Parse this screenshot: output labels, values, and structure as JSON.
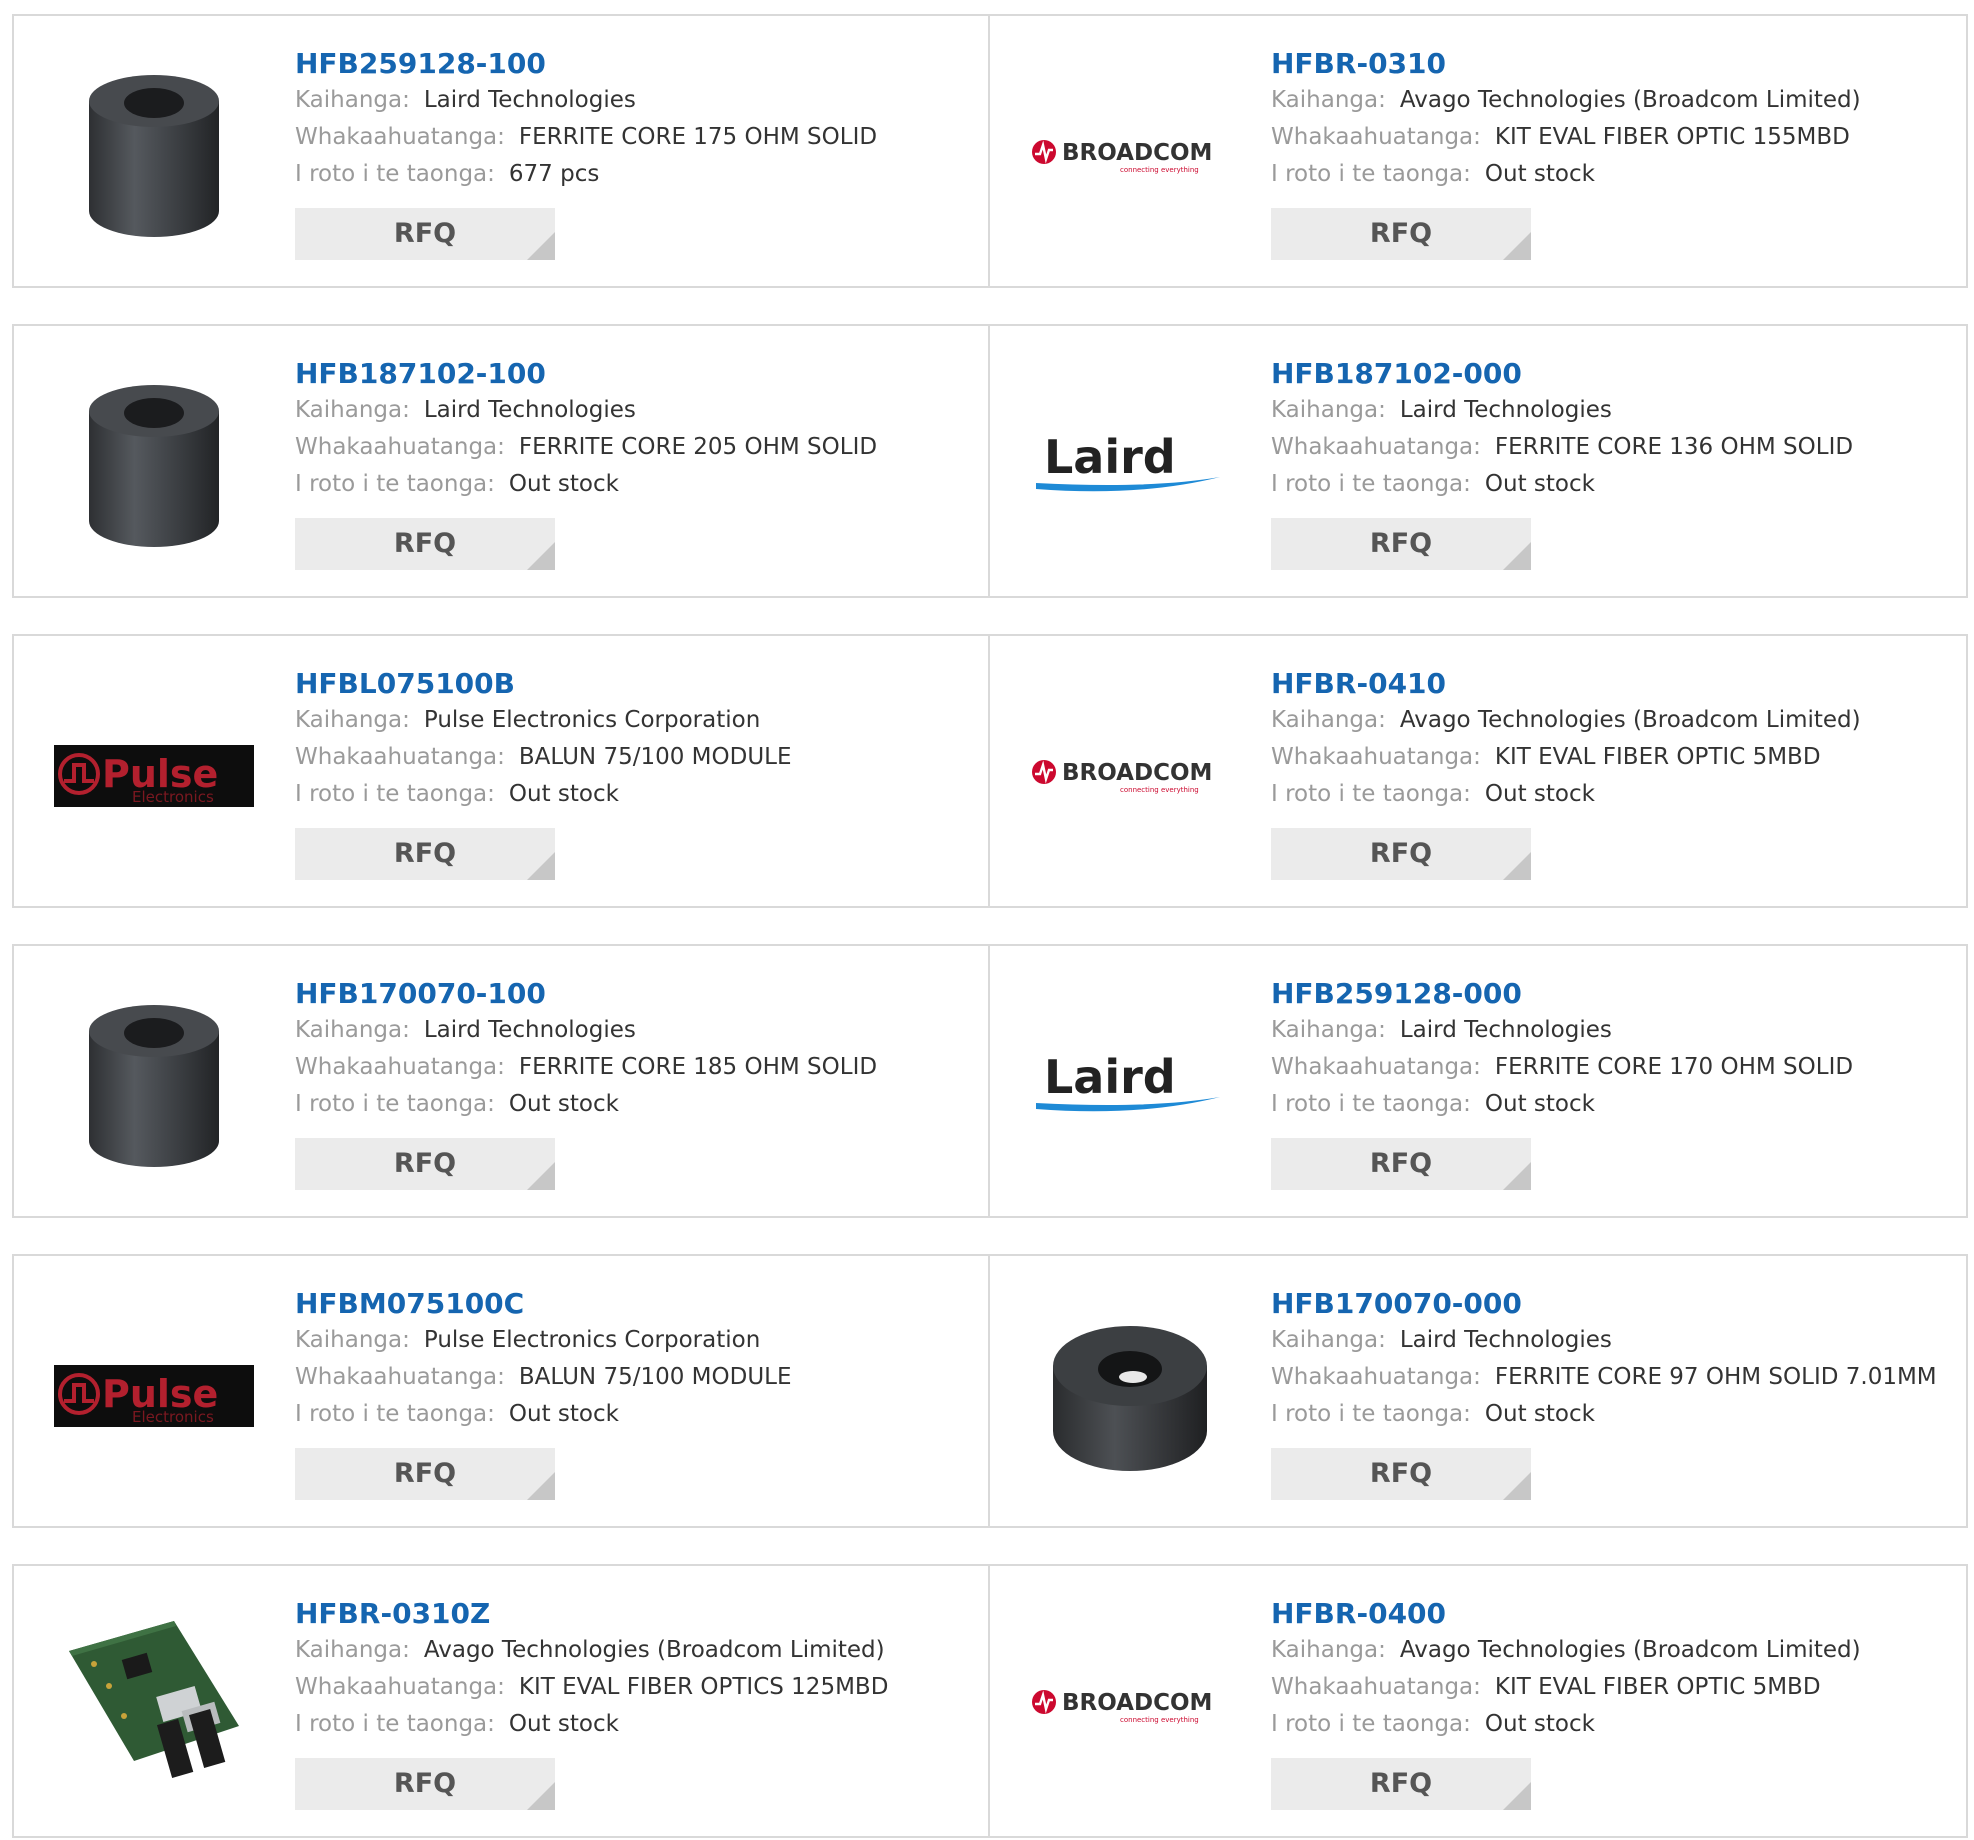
{
  "labels": {
    "manufacturer": "Kaihanga:",
    "description": "Whakaahuatanga:",
    "stock": "I roto i te taonga:",
    "rfq": "RFQ"
  },
  "logo_text": {
    "broadcom": "BROADCOM",
    "broadcom_tagline": "connecting everything",
    "laird": "Laird",
    "pulse": "Pulse",
    "pulse_sub": "Electronics"
  },
  "products": [
    {
      "part": "HFB259128-100",
      "manufacturer": "Laird Technologies",
      "description": "FERRITE CORE 175 OHM SOLID",
      "stock": "677 pcs",
      "image": "ferrite-core-tall"
    },
    {
      "part": "HFBR-0310",
      "manufacturer": "Avago Technologies (Broadcom Limited)",
      "description": "KIT EVAL FIBER OPTIC 155MBD",
      "stock": "Out stock",
      "image": "broadcom-logo"
    },
    {
      "part": "HFB187102-100",
      "manufacturer": "Laird Technologies",
      "description": "FERRITE CORE 205 OHM SOLID",
      "stock": "Out stock",
      "image": "ferrite-core-tall"
    },
    {
      "part": "HFB187102-000",
      "manufacturer": "Laird Technologies",
      "description": "FERRITE CORE 136 OHM SOLID",
      "stock": "Out stock",
      "image": "laird-logo"
    },
    {
      "part": "HFBL075100B",
      "manufacturer": "Pulse Electronics Corporation",
      "description": "BALUN 75/100 MODULE",
      "stock": "Out stock",
      "image": "pulse-logo"
    },
    {
      "part": "HFBR-0410",
      "manufacturer": "Avago Technologies (Broadcom Limited)",
      "description": "KIT EVAL FIBER OPTIC 5MBD",
      "stock": "Out stock",
      "image": "broadcom-logo"
    },
    {
      "part": "HFB170070-100",
      "manufacturer": "Laird Technologies",
      "description": "FERRITE CORE 185 OHM SOLID",
      "stock": "Out stock",
      "image": "ferrite-core-tall"
    },
    {
      "part": "HFB259128-000",
      "manufacturer": "Laird Technologies",
      "description": "FERRITE CORE 170 OHM SOLID",
      "stock": "Out stock",
      "image": "laird-logo"
    },
    {
      "part": "HFBM075100C",
      "manufacturer": "Pulse Electronics Corporation",
      "description": "BALUN 75/100 MODULE",
      "stock": "Out stock",
      "image": "pulse-logo"
    },
    {
      "part": "HFB170070-000",
      "manufacturer": "Laird Technologies",
      "description": "FERRITE CORE 97 OHM SOLID 7.01MM",
      "stock": "Out stock",
      "image": "ferrite-core-wide"
    },
    {
      "part": "HFBR-0310Z",
      "manufacturer": "Avago Technologies (Broadcom Limited)",
      "description": "KIT EVAL FIBER OPTICS 125MBD",
      "stock": "Out stock",
      "image": "fiber-optic-board"
    },
    {
      "part": "HFBR-0400",
      "manufacturer": "Avago Technologies (Broadcom Limited)",
      "description": "KIT EVAL FIBER OPTIC 5MBD",
      "stock": "Out stock",
      "image": "broadcom-logo"
    }
  ],
  "colors": {
    "part_link": "#1565b0",
    "label": "#9a9a9a",
    "value": "#333333",
    "border": "#d9d9d9",
    "button_bg": "#ebebeb",
    "broadcom_red": "#cc092f",
    "laird_swoosh": "#1e8ad6",
    "pulse_red": "#b3202e"
  }
}
